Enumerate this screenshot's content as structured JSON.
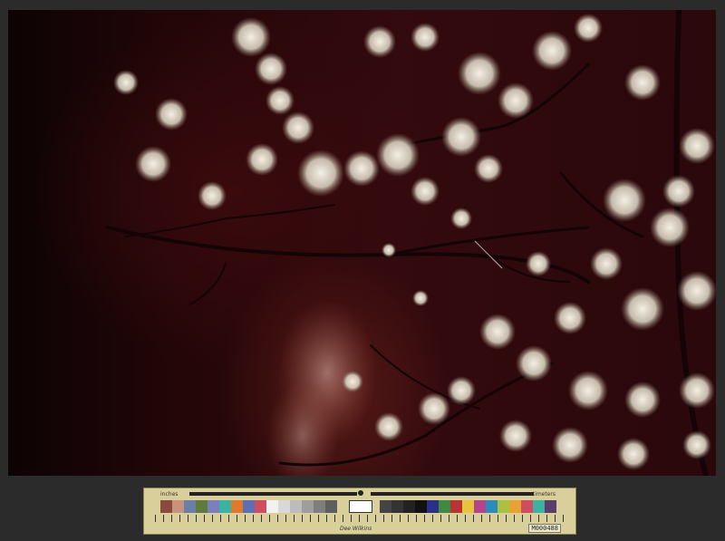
{
  "photo": {
    "subject": "cherry blossom branches",
    "palette": {
      "background": "#2a080b",
      "blossom": "#e9e4d6",
      "branch": "#1a0708"
    }
  },
  "color_card": {
    "label_left": "inches",
    "label_right": "centimeters",
    "brand": "Dee Wilkins",
    "code": "M000488",
    "swatches_left": [
      "#8a4a3c",
      "#c9927e",
      "#6a7ea6",
      "#5f7a3c",
      "#7d7fbd",
      "#3cb2a5",
      "#e0792a",
      "#5d6fb3",
      "#cf4d5f",
      "#5b3d6b",
      "#a9c244",
      "#e6a333"
    ],
    "swatches_right": [
      "#2c2f86",
      "#3e8a43",
      "#b93534",
      "#e7c43c",
      "#b6448c",
      "#2c8bb8",
      "#f2f2f2",
      "#c8c8c8",
      "#a0a0a0",
      "#7a7a7a",
      "#555",
      "#333",
      "#111"
    ]
  }
}
